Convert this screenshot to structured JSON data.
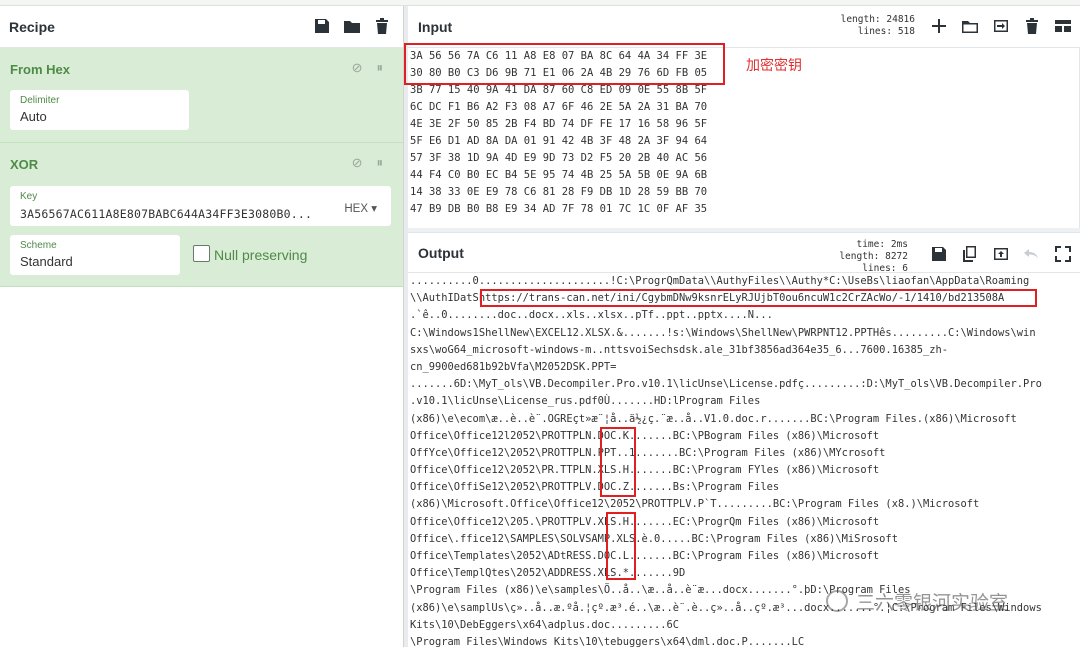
{
  "recipe": {
    "title": "Recipe",
    "operations": [
      {
        "name": "From Hex",
        "delimiter_label": "Delimiter",
        "delimiter_value": "Auto"
      },
      {
        "name": "XOR",
        "key_label": "Key",
        "key_value": "3A56567AC611A8E807BABC644A34FF3E3080B0...",
        "key_format": "HEX ▾",
        "scheme_label": "Scheme",
        "scheme_value": "Standard",
        "null_preserving_label": "Null preserving"
      }
    ],
    "pause_glyph": "⏸",
    "disable_glyph": "⊘"
  },
  "input": {
    "title": "Input",
    "length_label": "length:",
    "length_value": "24816",
    "lines_label": "lines:",
    "lines_value": "518",
    "annotation": "加密密钥",
    "lines": [
      "3A 56 56 7A C6 11 A8 E8 07 BA 8C 64 4A 34 FF 3E",
      "30 80 B0 C3 D6 9B 71 E1 06 2A 4B 29 76 6D FB 05",
      "3B 77 15 40 9A 41 DA 87 60 C8 ED 09 0E 55 8B 5F",
      "6C DC F1 B6 A2 F3 08 A7 6F 46 2E 5A 2A 31 BA 70",
      "4E 3E 2F 50 85 2B F4 BD 74 DF FE 17 16 58 96 5F",
      "5F E6 D1 AD 8A DA 01 91 42 4B 3F 48 2A 3F 94 64",
      "57 3F 38 1D 9A 4D E9 9D 73 D2 F5 20 2B 40 AC 56",
      "44 F4 C0 B0 EC B4 5E 95 74 4B 25 5A 5B 0E 9A 6B",
      "14 38 33 0E E9 78 C6 81 28 F9 DB 1D 28 59 BB 70",
      "47 B9 DB B0 B8 E9 34 AD 7F 78 01 7C 1C 0F AF 35"
    ]
  },
  "output": {
    "title": "Output",
    "time_label": "time:",
    "time_value": "2ms",
    "length_label": "length:",
    "length_value": "8272",
    "lines_label": "lines:",
    "lines_value": "6",
    "lines": [
      "..........0.....................!C:\\ProgrQmData\\\\AuthyFiles\\\\Authy*C:\\UseBs\\liaofan\\AppData\\Roaming",
      "\\\\AuthIDatShttps://trans-can.net/ini/CgybmDNw9ksnrELyRJUjbT0ou6ncuW1c2CrZAcWo/-1/1410/bd213508A",
      ".`ê..0........doc..docx..xls..xlsx..pTf..ppt..pptx....N...",
      "C:\\Windows1ShellNew\\EXCEL12.XLSX.&.......!s:\\Windows\\ShellNew\\PWRPNT12.PPTHês.........C:\\Windows\\win",
      "sxs\\woG64_microsoft-windows-m..nttsvoiSechsdsk.ale_31bf3856ad364e35_6...7600.16385_zh-",
      "cn_9900ed681b92bVfa\\M2052DSK.PPT=",
      ".......6D:\\MyT_ols\\VB.Decompiler.Pro.v10.1\\licUnse\\License.pdfç.........:D:\\MyT_ols\\VB.Decompiler.Pro",
      ".v10.1\\licUnse\\License_rus.pdf0Ù.......HD:lProgram Files",
      "(x86)\\e\\ecom\\æ..è..è¨.OGREçt»æ¨¦å..ä½¿ç.¨æ..å..V1.0.doc.r.......BC:\\Program Files.(x86)\\Microsoft",
      "Office\\Office12l2052\\PROTTPLN.DOC.K.......BC:\\PBogram Files (x86)\\Microsoft",
      "OffYce\\Office12\\2052\\PROTTPLN.PPT..1.......BC:\\Program Files (x86)\\MYcrosoft",
      "Office\\Office12\\2052\\PR.TTPLN.XLS.H.......BC:\\Program FYles (x86)\\Microsoft",
      "Office\\OffiSe12\\2052\\PROTTPLV.DOC.Z.......Bs:\\Program Files",
      "(x86)\\Microsoft.Office\\Office12\\2052\\PROTTPLV.P`T.........BC:\\Program Files (x8.)\\Microsoft",
      "Office\\Office12\\205.\\PROTTPLV.XLS.H.......EC:\\ProgrQm Files (x86)\\Microsoft",
      "Office\\.ffice12\\SAMPLES\\SOLVSAMP.XLS.è.0.....BC:\\Program Files (x86)\\MiSrosoft",
      "Office\\Templates\\2052\\ADtRESS.DOC.L.......BC:\\Program Files (x86)\\Microsoft",
      "Office\\TemplQtes\\2052\\ADDRESS.XLS.*.......9D",
      "\\Program Files (x86)\\e\\samples\\Ö..å..\\æ..å..è¨æ...docx.......°.þD:\\Program Files",
      "(x86)\\e\\samplUs\\ç»..å..æ.ºå.¦çº.æ³.é..\\æ..è¨.è..ç»..å..çº.æ³...docx.......°.¦C:\\Program Files\\Windows",
      "Kits\\10\\DebEggers\\x64\\adplus.doc.........6C",
      "\\Program Files\\Windows Kits\\10\\tebuggers\\x64\\dml.doc.P.......LC"
    ]
  },
  "watermark": "三六零银河实验室"
}
